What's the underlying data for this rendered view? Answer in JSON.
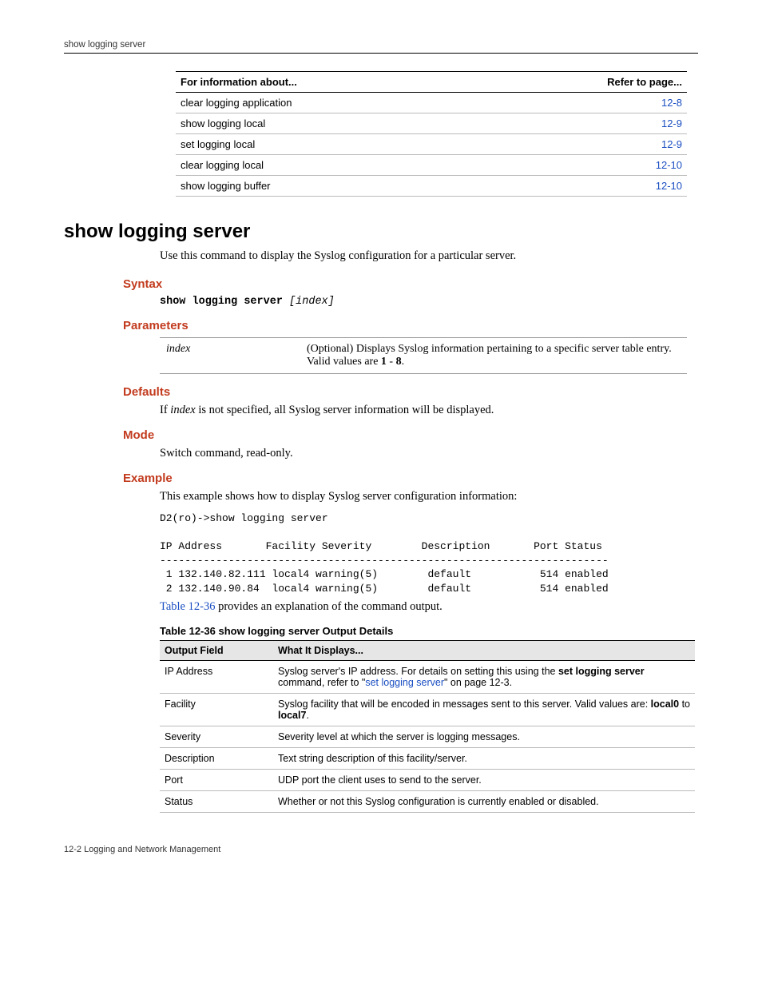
{
  "runningHead": "show logging server",
  "infoTable": {
    "headers": [
      "For information about...",
      "Refer to page..."
    ],
    "rows": [
      {
        "about": "clear logging application",
        "page": "12-8"
      },
      {
        "about": "show logging local",
        "page": "12-9"
      },
      {
        "about": "set logging local",
        "page": "12-9"
      },
      {
        "about": "clear logging local",
        "page": "12-10"
      },
      {
        "about": "show logging buffer",
        "page": "12-10"
      }
    ]
  },
  "title": "show logging server",
  "intro": "Use this command to display the Syslog configuration for a particular server.",
  "syntax": {
    "heading": "Syntax",
    "cmd": "show logging server",
    "arg": "[index]"
  },
  "parameters": {
    "heading": "Parameters",
    "rows": [
      {
        "name": "index",
        "desc_pre": "(Optional) Displays Syslog information pertaining to a specific server table entry. Valid values are ",
        "desc_bold1": "1",
        "desc_mid": " - ",
        "desc_bold2": "8",
        "desc_post": "."
      }
    ]
  },
  "defaults": {
    "heading": "Defaults",
    "pre": "If ",
    "ital": "index",
    "post": " is not specified, all Syslog server information will be displayed."
  },
  "mode": {
    "heading": "Mode",
    "text": "Switch command, read-only."
  },
  "example": {
    "heading": "Example",
    "lead": "This example shows how to display Syslog server configuration information:",
    "code": "D2(ro)->show logging server\n\nIP Address       Facility Severity        Description       Port Status\n------------------------------------------------------------------------\n 1 132.140.82.111 local4 warning(5)        default           514 enabled\n 2 132.140.90.84  local4 warning(5)        default           514 enabled",
    "tableRefLink": "Table 12-36",
    "tableRefRest": " provides an explanation of the command output."
  },
  "outputTable": {
    "captionNum": "Table 12-36",
    "captionRest": "   show logging server Output Details",
    "headers": [
      "Output Field",
      "What It Displays..."
    ],
    "rows": [
      {
        "f": "IP Address",
        "d_pre": "Syslog server's IP address. For details on setting this using the ",
        "d_bold": "set logging server",
        "d_mid": " command, refer to \"",
        "d_link": "set logging server",
        "d_post": "\" on page 12-3."
      },
      {
        "f": "Facility",
        "d_pre": "Syslog facility that will be encoded in messages sent to this server. Valid values are: ",
        "d_bold": "local0",
        "d_mid": " to ",
        "d_bold2": "local7",
        "d_post": "."
      },
      {
        "f": "Severity",
        "d_pre": "Severity level at which the server is logging messages."
      },
      {
        "f": "Description",
        "d_pre": "Text string description of this facility/server."
      },
      {
        "f": "Port",
        "d_pre": "UDP port the client uses to send to the server."
      },
      {
        "f": "Status",
        "d_pre": "Whether or not this Syslog configuration is currently enabled or disabled."
      }
    ]
  },
  "footer": "12-2   Logging and Network Management"
}
